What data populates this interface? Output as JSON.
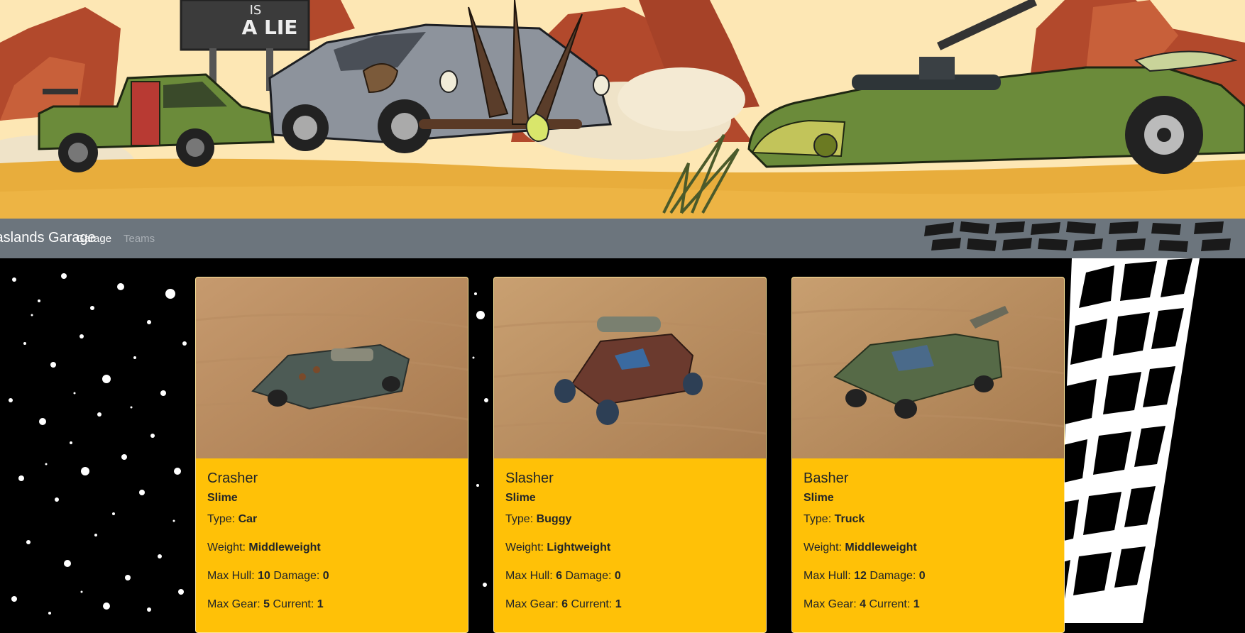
{
  "banner": {
    "sign_text": "A LIE",
    "sign_text_partial": "IS",
    "colors": {
      "sky": "#fde7b4",
      "sand": "#e8ad3c",
      "mesa": "#b2492c",
      "green_car": "#6b8b3a",
      "grey_car": "#8d939c"
    }
  },
  "navbar": {
    "brand": "Gaslands Garage",
    "links": [
      {
        "label": "Garage",
        "active": true
      },
      {
        "label": "Teams",
        "active": false
      }
    ],
    "bg_color": "#6c757d"
  },
  "cards": [
    {
      "name": "Crasher",
      "team": "Slime",
      "type_label": "Type:",
      "type": "Car",
      "weight_label": "Weight:",
      "weight": "Middleweight",
      "hull_label": "Max Hull:",
      "hull": "10",
      "damage_label": "Damage:",
      "damage": "0",
      "gear_label": "Max Gear:",
      "gear": "5",
      "current_label": "Current:",
      "current": "1",
      "photo_color": "#4d5b55"
    },
    {
      "name": "Slasher",
      "team": "Slime",
      "type_label": "Type:",
      "type": "Buggy",
      "weight_label": "Weight:",
      "weight": "Lightweight",
      "hull_label": "Max Hull:",
      "hull": "6",
      "damage_label": "Damage:",
      "damage": "0",
      "gear_label": "Max Gear:",
      "gear": "6",
      "current_label": "Current:",
      "current": "1",
      "photo_color": "#6b3a2e"
    },
    {
      "name": "Basher",
      "team": "Slime",
      "type_label": "Type:",
      "type": "Truck",
      "weight_label": "Weight:",
      "weight": "Middleweight",
      "hull_label": "Max Hull:",
      "hull": "12",
      "damage_label": "Damage:",
      "damage": "0",
      "gear_label": "Max Gear:",
      "gear": "4",
      "current_label": "Current:",
      "current": "1",
      "photo_color": "#566a47"
    }
  ],
  "card_color": "#ffc107"
}
